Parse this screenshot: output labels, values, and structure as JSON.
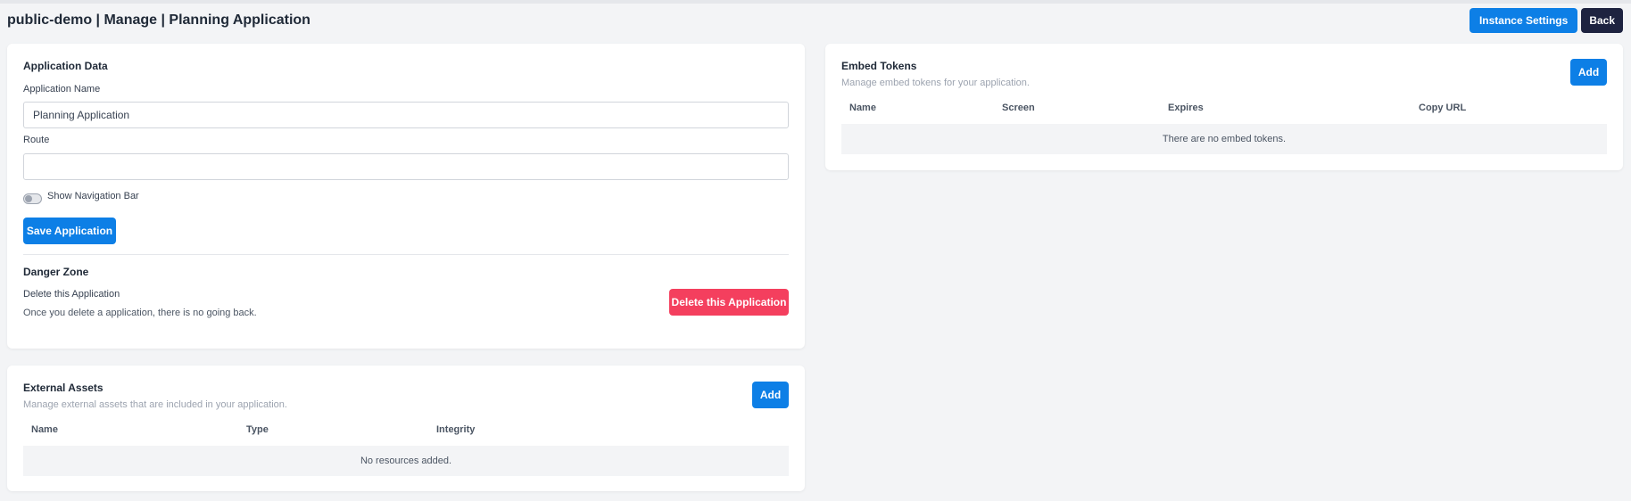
{
  "header": {
    "title": "public-demo | Manage | Planning Application",
    "instance_settings_label": "Instance Settings",
    "back_label": "Back"
  },
  "application_data": {
    "heading": "Application Data",
    "name_label": "Application Name",
    "name_value": "Planning Application",
    "route_label": "Route",
    "route_value": "",
    "nav_toggle_label": "Show Navigation Bar",
    "nav_toggle_on": false,
    "save_label": "Save Application"
  },
  "danger_zone": {
    "heading": "Danger Zone",
    "title": "Delete this Application",
    "description": "Once you delete a application, there is no going back.",
    "delete_label": "Delete this Application"
  },
  "external_assets": {
    "heading": "External Assets",
    "description": "Manage external assets that are included in your application.",
    "add_label": "Add",
    "columns": [
      "Name",
      "Type",
      "Integrity"
    ],
    "empty_text": "No resources added."
  },
  "embed_tokens": {
    "heading": "Embed Tokens",
    "description": "Manage embed tokens for your application.",
    "add_label": "Add",
    "columns": [
      "Name",
      "Screen",
      "Expires",
      "Copy URL"
    ],
    "empty_text": "There are no embed tokens."
  },
  "colors": {
    "primary": "#0d7fe6",
    "dark": "#1e2340",
    "danger": "#f43f5e",
    "background": "#f3f4f6"
  }
}
